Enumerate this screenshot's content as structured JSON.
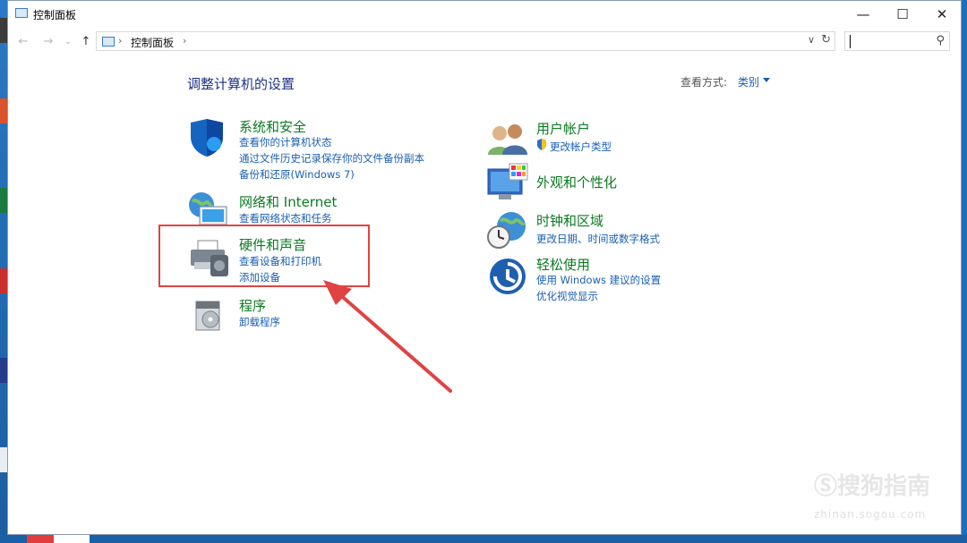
{
  "window": {
    "title": "控制面板"
  },
  "controls": {
    "minimize": "—",
    "maximize": "☐",
    "close": "✕"
  },
  "nav": {
    "back": "←",
    "forward": "→",
    "recent": "⌄",
    "up": "↑",
    "breadcrumb": "控制面板",
    "sep": "›",
    "dropdown": "∨",
    "refresh": "↻"
  },
  "search": {
    "placeholder": "",
    "icon": "⚲"
  },
  "page": {
    "title": "调整计算机的设置",
    "view_by_label": "查看方式:",
    "view_by_value": "类别"
  },
  "left_categories": [
    {
      "icon": "shield-icon",
      "title": "系统和安全",
      "links": [
        "查看你的计算机状态",
        "通过文件历史记录保存你的文件备份副本",
        "备份和还原(Windows 7)"
      ]
    },
    {
      "icon": "network-icon",
      "title": "网络和 Internet",
      "links": [
        "查看网络状态和任务"
      ]
    },
    {
      "icon": "printer-icon",
      "title": "硬件和声音",
      "links": [
        "查看设备和打印机",
        "添加设备"
      ]
    },
    {
      "icon": "programs-icon",
      "title": "程序",
      "links": [
        "卸载程序"
      ]
    }
  ],
  "right_categories": [
    {
      "icon": "users-icon",
      "title": "用户帐户",
      "links": [
        "更改帐户类型"
      ]
    },
    {
      "icon": "appearance-icon",
      "title": "外观和个性化",
      "links": []
    },
    {
      "icon": "clock-globe-icon",
      "title": "时钟和区域",
      "links": [
        "更改日期、时间或数字格式"
      ]
    },
    {
      "icon": "ease-of-access-icon",
      "title": "轻松使用",
      "links": [
        "使用 Windows 建议的设置",
        "优化视觉显示"
      ]
    }
  ],
  "watermark": {
    "text": "Ⓢ搜狗指南",
    "sub": "zhinan.sogou.com"
  },
  "colors": {
    "heading": "#0b7a22",
    "link": "#1a5fb4",
    "highlight": "#e04343"
  }
}
